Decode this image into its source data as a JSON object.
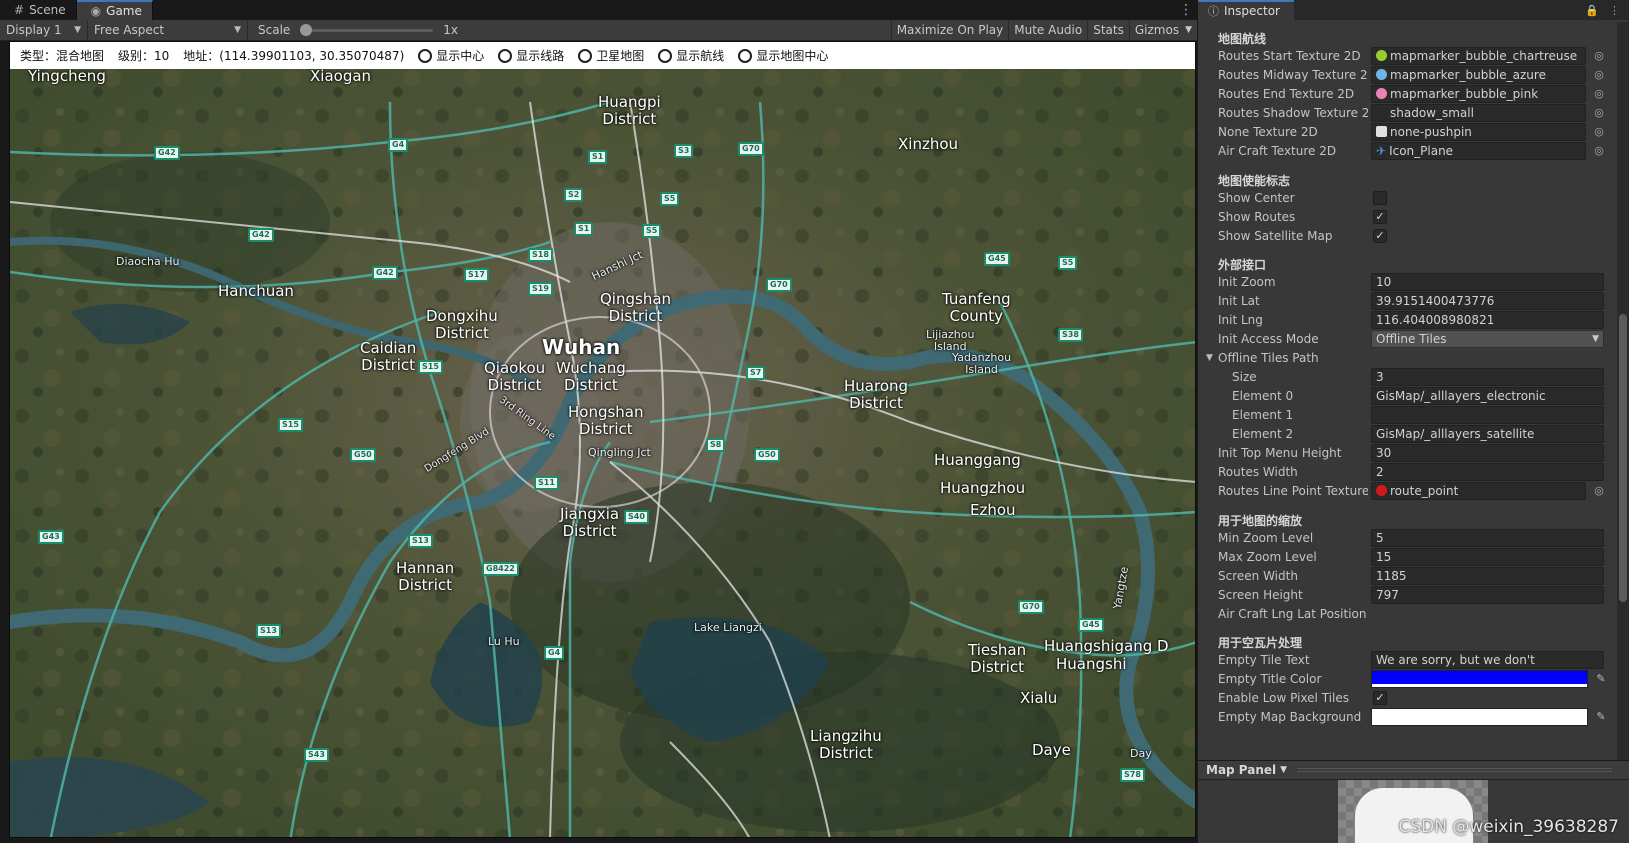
{
  "tabs": [
    {
      "label": "Scene",
      "icon": "grid-icon"
    },
    {
      "label": "Game",
      "icon": "gamepad-icon"
    }
  ],
  "toolbar": {
    "display": "Display 1",
    "aspect": "Free Aspect",
    "scale_label": "Scale",
    "scale_value": "1x",
    "scale_fraction": 0.0,
    "buttons": [
      "Maximize On Play",
      "Mute Audio",
      "Stats",
      "Gizmos"
    ]
  },
  "game_menu": {
    "type_label": "类型：混合地图",
    "level_label": "级别：10",
    "location_label": "地址：(114.39901103, 30.35070487)",
    "options": [
      "显示中心",
      "显示线路",
      "卫星地图",
      "显示航线",
      "显示地图中心"
    ]
  },
  "map_labels": [
    {
      "text": "Yingcheng",
      "cls": ""
    },
    {
      "text": "Xiaogan",
      "cls": ""
    },
    {
      "text": "Huangpi\nDistrict",
      "cls": ""
    },
    {
      "text": "Xinzhou",
      "cls": ""
    },
    {
      "text": "Diaocha Hu",
      "cls": "small"
    },
    {
      "text": "Hanchuan",
      "cls": ""
    },
    {
      "text": "Dongxihu\nDistrict",
      "cls": ""
    },
    {
      "text": "Qingshan\nDistrict",
      "cls": ""
    },
    {
      "text": "Tuanfeng\nCounty",
      "cls": ""
    },
    {
      "text": "Lijiazhou\nIsland",
      "cls": "small"
    },
    {
      "text": "Yadanzhou\nIsland",
      "cls": "small"
    },
    {
      "text": "Caidian\nDistrict",
      "cls": ""
    },
    {
      "text": "Wuhan",
      "cls": "big"
    },
    {
      "text": "Wuchang\nDistrict",
      "cls": ""
    },
    {
      "text": "Qiaokou\nDistrict",
      "cls": ""
    },
    {
      "text": "Huarong\nDistrict",
      "cls": ""
    },
    {
      "text": "Hongshan\nDistrict",
      "cls": ""
    },
    {
      "text": "Huanggang",
      "cls": ""
    },
    {
      "text": "Huangzhou",
      "cls": ""
    },
    {
      "text": "Ezhou",
      "cls": ""
    },
    {
      "text": "Jiangxia\nDistrict",
      "cls": ""
    },
    {
      "text": "Hannan\nDistrict",
      "cls": ""
    },
    {
      "text": "Lu Hu",
      "cls": "small"
    },
    {
      "text": "Lake Liangzi",
      "cls": "small"
    },
    {
      "text": "Tieshan\nDistrict",
      "cls": ""
    },
    {
      "text": "Huangshigang D",
      "cls": ""
    },
    {
      "text": "Huangshi",
      "cls": ""
    },
    {
      "text": "Xialu",
      "cls": ""
    },
    {
      "text": "Liangzihu\nDistrict",
      "cls": ""
    },
    {
      "text": "Daye",
      "cls": ""
    },
    {
      "text": "Day",
      "cls": "small"
    },
    {
      "text": "Yangtze",
      "cls": "small"
    },
    {
      "text": "Dongfeng Blvd",
      "cls": "road"
    },
    {
      "text": "3rd Ring Line",
      "cls": "road"
    },
    {
      "text": "Qingling Jct",
      "cls": "small"
    },
    {
      "text": "Hanshi Jct",
      "cls": "small"
    }
  ],
  "highway_shields": [
    "G42",
    "G4",
    "S1",
    "S3",
    "G70",
    "S2",
    "S5",
    "G42",
    "S1",
    "S5",
    "G42",
    "S17",
    "S18",
    "S19",
    "G70",
    "G45",
    "S5",
    "S38",
    "S15",
    "S7",
    "S15",
    "G50",
    "S8",
    "G50",
    "S11",
    "S40",
    "S13",
    "G8422",
    "G43",
    "S13",
    "G4",
    "G70",
    "G45",
    "S43",
    "S78"
  ],
  "inspector": {
    "tab_label": "Inspector",
    "sections": {
      "routes": "地图航线",
      "display": "地图使能标志",
      "external": "外部接口",
      "zoom": "用于地图的缩放",
      "empty": "用于空瓦片处理"
    },
    "texture_rows": [
      {
        "label": "Routes Start Texture 2D",
        "value": "mapmarker_bubble_chartreuse",
        "icon_color": "#9acd32"
      },
      {
        "label": "Routes Midway Texture 2D",
        "value": "mapmarker_bubble_azure",
        "icon_color": "#6fb4e6"
      },
      {
        "label": "Routes End Texture 2D",
        "value": "mapmarker_bubble_pink",
        "icon_color": "#e884b5"
      },
      {
        "label": "Routes Shadow Texture 2D",
        "value": "shadow_small",
        "icon_color": "#2a2a2a"
      },
      {
        "label": "None Texture 2D",
        "value": "none-pushpin",
        "icon_color": "#e0e0e0"
      },
      {
        "label": "Air Craft Texture 2D",
        "value": "Icon_Plane",
        "icon_color": "#4a90d9"
      }
    ],
    "toggles": [
      {
        "label": "Show Center",
        "checked": false
      },
      {
        "label": "Show Routes",
        "checked": true
      },
      {
        "label": "Show Satellite Map",
        "checked": true
      }
    ],
    "init_zoom": {
      "label": "Init Zoom",
      "value": "10"
    },
    "init_lat": {
      "label": "Init Lat",
      "value": "39.9151400473776"
    },
    "init_lng": {
      "label": "Init Lng",
      "value": "116.404008980821"
    },
    "init_access_mode": {
      "label": "Init Access Mode",
      "value": "Offline Tiles"
    },
    "offline_tiles_path": {
      "label": "Offline Tiles Path"
    },
    "size": {
      "label": "Size",
      "value": "3"
    },
    "element0": {
      "label": "Element 0",
      "value": "GisMap/_alllayers_electronic"
    },
    "element1": {
      "label": "Element 1",
      "value": ""
    },
    "element2": {
      "label": "Element 2",
      "value": "GisMap/_alllayers_satellite"
    },
    "top_menu_height": {
      "label": "Init Top Menu Height",
      "value": "30"
    },
    "routes_width": {
      "label": "Routes Width",
      "value": "2"
    },
    "line_point_texture": {
      "label": "Routes Line Point Texture",
      "value": "route_point",
      "icon_color": "#d11a1a"
    },
    "min_zoom": {
      "label": "Min Zoom Level",
      "value": "5"
    },
    "max_zoom": {
      "label": "Max Zoom Level",
      "value": "15"
    },
    "screen_width": {
      "label": "Screen Width",
      "value": "1185"
    },
    "screen_height": {
      "label": "Screen Height",
      "value": "797"
    },
    "aircraft_pos": {
      "label": "Air Craft Lng Lat Position"
    },
    "empty_tile_text": {
      "label": "Empty Tile Text",
      "value": "We are sorry, but we don't"
    },
    "empty_title_color": {
      "label": "Empty Title Color",
      "value": "#0000ff"
    },
    "low_pixel": {
      "label": "Enable Low Pixel Tiles",
      "checked": true
    },
    "empty_map_bg": {
      "label": "Empty Map Background",
      "value": "#ffffff"
    }
  },
  "map_panel": {
    "label": "Map Panel"
  },
  "watermark": "CSDN @weixin_39638287"
}
